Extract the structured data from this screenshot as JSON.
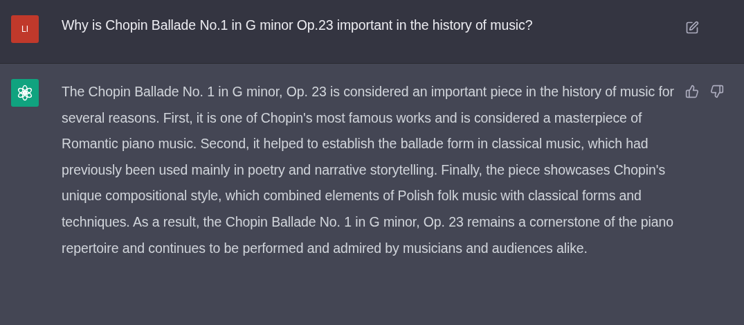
{
  "messages": [
    {
      "kind": "user",
      "avatar_initials": "LI",
      "text": "Why is Chopin Ballade No.1 in G minor Op.23 important in the history of music?"
    },
    {
      "kind": "assistant",
      "text": "The Chopin Ballade No. 1 in G minor, Op. 23 is considered an important piece in the history of music for several reasons. First, it is one of Chopin's most famous works and is considered a masterpiece of Romantic piano music. Second, it helped to establish the ballade form in classical music, which had previously been used mainly in poetry and narrative storytelling. Finally, the piece showcases Chopin's unique compositional style, which combined elements of Polish folk music with classical forms and techniques. As a result, the Chopin Ballade No. 1 in G minor, Op. 23 remains a cornerstone of the piano repertoire and continues to be performed and admired by musicians and audiences alike."
    }
  ]
}
